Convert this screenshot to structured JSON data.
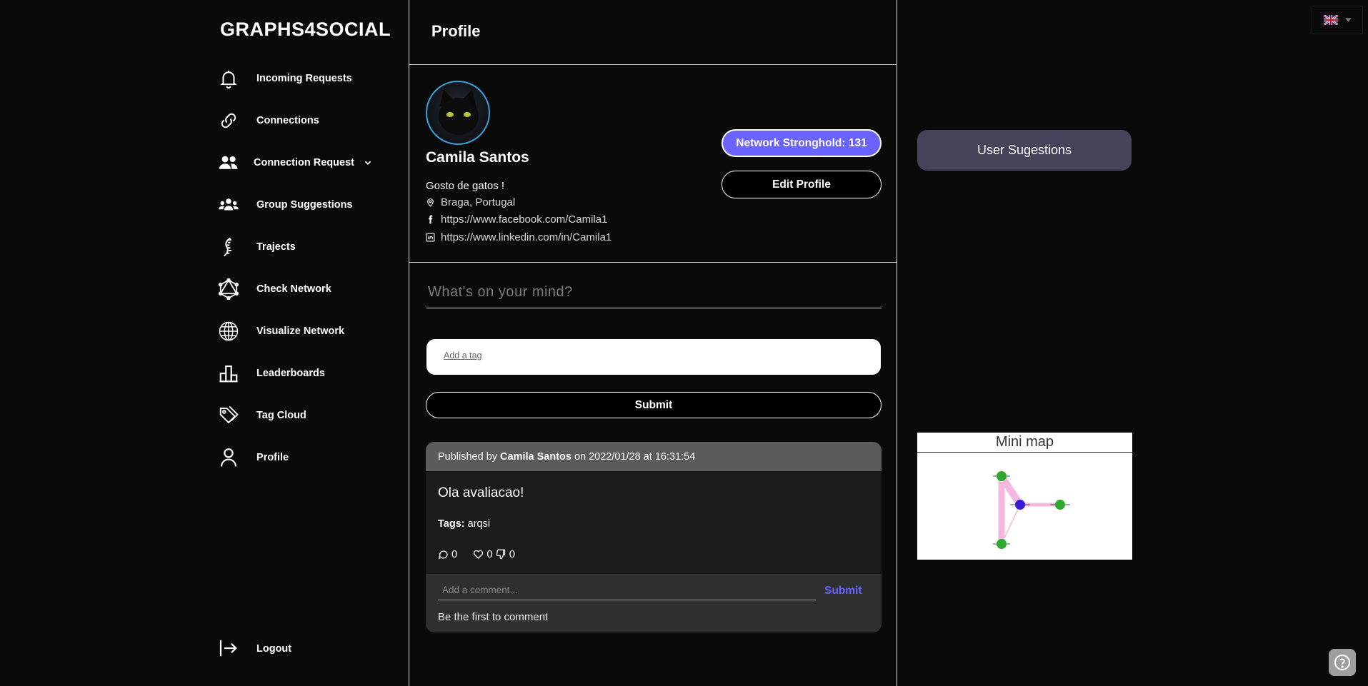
{
  "brand": "GRAPHS4SOCIAL",
  "nav": [
    {
      "label": "Incoming Requests",
      "icon": "bell-icon"
    },
    {
      "label": "Connections",
      "icon": "link-icon"
    },
    {
      "label": "Connection Request",
      "icon": "users-icon"
    },
    {
      "label": "Group Suggestions",
      "icon": "group-icon"
    },
    {
      "label": "Trajects",
      "icon": "traject-icon"
    },
    {
      "label": "Check Network",
      "icon": "network-icon"
    },
    {
      "label": "Visualize Network",
      "icon": "globe-icon"
    },
    {
      "label": "Leaderboards",
      "icon": "podium-icon"
    },
    {
      "label": "Tag Cloud",
      "icon": "tags-icon"
    },
    {
      "label": "Profile",
      "icon": "user-icon"
    }
  ],
  "logout_label": "Logout",
  "header": {
    "title": "Profile"
  },
  "profile": {
    "name": "Camila Santos",
    "bio": "Gosto de gatos !",
    "location": "Braga, Portugal",
    "facebook": "https://www.facebook.com/Camila1",
    "linkedin": "https://www.linkedin.com/in/Camila1",
    "stronghold_label": "Network Stronghold: 131",
    "edit_label": "Edit Profile"
  },
  "composer": {
    "placeholder": "What's on your mind?",
    "tag_placeholder": "Add a tag",
    "submit_label": "Submit"
  },
  "post": {
    "published_by_prefix": "Published by",
    "author": "Camila Santos",
    "date_text": "on 2022/01/28 at 16:31:54",
    "text": "Ola avaliacao!",
    "tags_label": "Tags:",
    "tags": "arqsi",
    "comments": "0",
    "likes": "0",
    "dislikes": "0",
    "comment_placeholder": "Add a comment...",
    "comment_submit": "Submit",
    "empty_comments": "Be the first to comment"
  },
  "right": {
    "user_suggestions": "User Sugestions",
    "minimap_title": "Mini map"
  },
  "colors": {
    "accent": "#6b63ff",
    "avatar_ring": "#3aa2d8",
    "suggestions_bg": "#454359"
  }
}
